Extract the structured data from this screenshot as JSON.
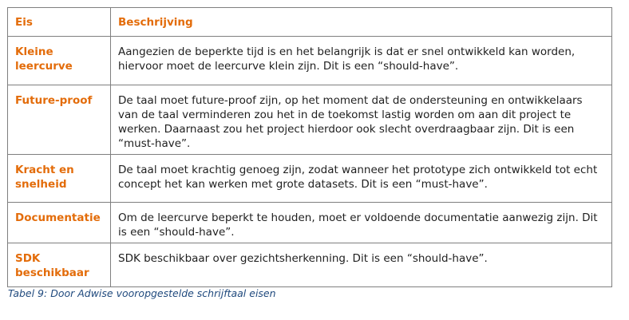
{
  "table": {
    "headers": {
      "requirement": "Eis",
      "description": "Beschrijving"
    },
    "rows": [
      {
        "requirement": "Kleine leercurve",
        "description": "Aangezien de beperkte tijd is en het belangrijk is dat er snel ontwikkeld kan worden, hiervoor moet de leercurve klein zijn. Dit is een “should-have”."
      },
      {
        "requirement": "Future-proof",
        "description": "De taal moet future-proof zijn, op het moment dat de ondersteuning en ontwikkelaars van de taal verminderen zou het in de toekomst lastig worden om aan dit project te werken. Daarnaast zou het project hierdoor ook slecht overdraagbaar zijn. Dit is een “must-have”."
      },
      {
        "requirement": "Kracht en snelheid",
        "description": "De taal moet krachtig genoeg zijn, zodat wanneer het prototype zich ontwikkeld tot echt concept het kan werken met grote datasets. Dit is een “must-have”."
      },
      {
        "requirement": "Documentatie",
        "description": "Om de leercurve beperkt te houden, moet er voldoende documentatie aanwezig zijn. Dit is een “should-have”."
      },
      {
        "requirement": "SDK beschikbaar",
        "description": "SDK beschikbaar over gezichtsherkenning. Dit is een “should-have”."
      }
    ]
  },
  "caption": "Tabel 9: Door Adwise vooropgestelde schrijftaal eisen",
  "colors": {
    "accent": "#e36c0a",
    "caption": "#1f497d",
    "border": "#7f7f7f"
  }
}
